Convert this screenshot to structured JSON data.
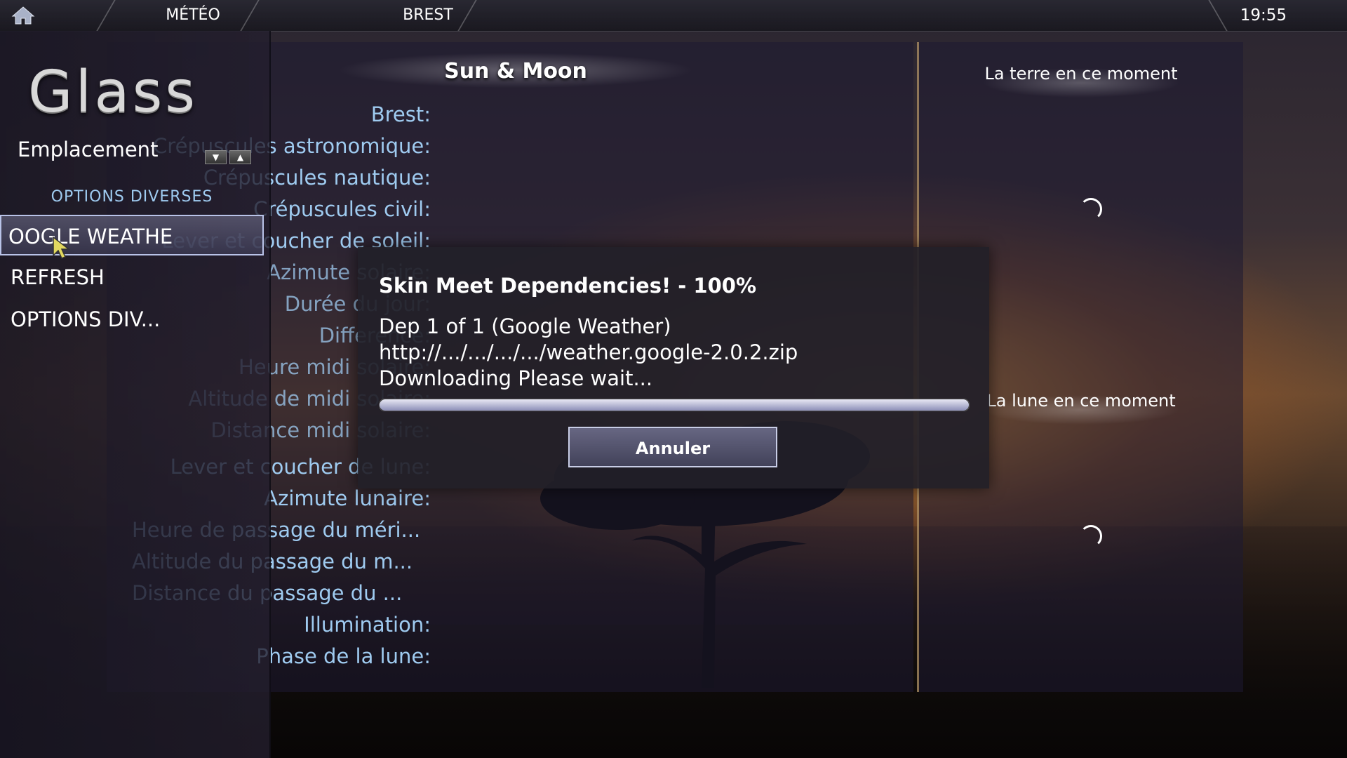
{
  "topbar": {
    "section": "MÉTÉO",
    "location": "BREST",
    "clock": "19:55"
  },
  "sidebar": {
    "logo": "Glass",
    "emplacement_label": "Emplacement",
    "options_header": "OPTIONS DIVERSES",
    "items": [
      {
        "label": "OOGLE WEATHE",
        "selected": true
      },
      {
        "label": "REFRESH",
        "selected": false
      },
      {
        "label": "OPTIONS DIV..."
      }
    ]
  },
  "main": {
    "title": "Sun & Moon",
    "labels": [
      "Brest:",
      "Crépuscules astronomique:",
      "Crépuscules nautique:",
      "Crépuscules civil:",
      "Lever et coucher de soleil:",
      "Azimute solaire:",
      "Durée du jour:",
      "Difference:",
      "Heure midi solaire:",
      "Altitude de midi solaire:",
      "Distance midi solaire:",
      "Lever et coucher de lune:",
      "Azimute lunaire:",
      "Heure de passage du méri...",
      "Altitude du passage du m...",
      "Distance du passage du ...",
      "Illumination:",
      "Phase de la lune:"
    ]
  },
  "right": {
    "earth_title": "La terre en ce moment",
    "moon_title": "La lune en ce moment"
  },
  "dialog": {
    "heading": "Skin Meet Dependencies! - 100%",
    "line1": "Dep 1 of 1 (Google Weather)",
    "line2": "http://.../.../.../.../weather.google-2.0.2.zip",
    "line3": "Downloading Please wait...",
    "progress_percent": 100,
    "cancel_label": "Annuler"
  },
  "colors": {
    "label_blue": "#9fcbf0",
    "accent_border": "#b9c3e8"
  }
}
